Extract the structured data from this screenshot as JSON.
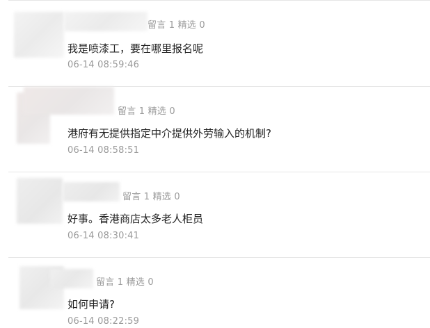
{
  "comments": [
    {
      "stats": {
        "reply_label": "留言",
        "reply_count": "1",
        "pick_label": "精选",
        "pick_count": "0"
      },
      "content": "我是喷漆工，要在哪里报名呢",
      "time": "06-14 08:59:46"
    },
    {
      "stats": {
        "reply_label": "留言",
        "reply_count": "1",
        "pick_label": "精选",
        "pick_count": "0"
      },
      "content": "港府有无提供指定中介提供外劳输入的机制?",
      "time": "06-14 08:58:51"
    },
    {
      "stats": {
        "reply_label": "留言",
        "reply_count": "1",
        "pick_label": "精选",
        "pick_count": "0"
      },
      "content": "好事。香港商店太多老人柜员",
      "time": "06-14 08:30:41"
    },
    {
      "stats": {
        "reply_label": "留言",
        "reply_count": "1",
        "pick_label": "精选",
        "pick_count": "0"
      },
      "content": "如何申请?",
      "time": "06-14 08:22:59"
    }
  ]
}
